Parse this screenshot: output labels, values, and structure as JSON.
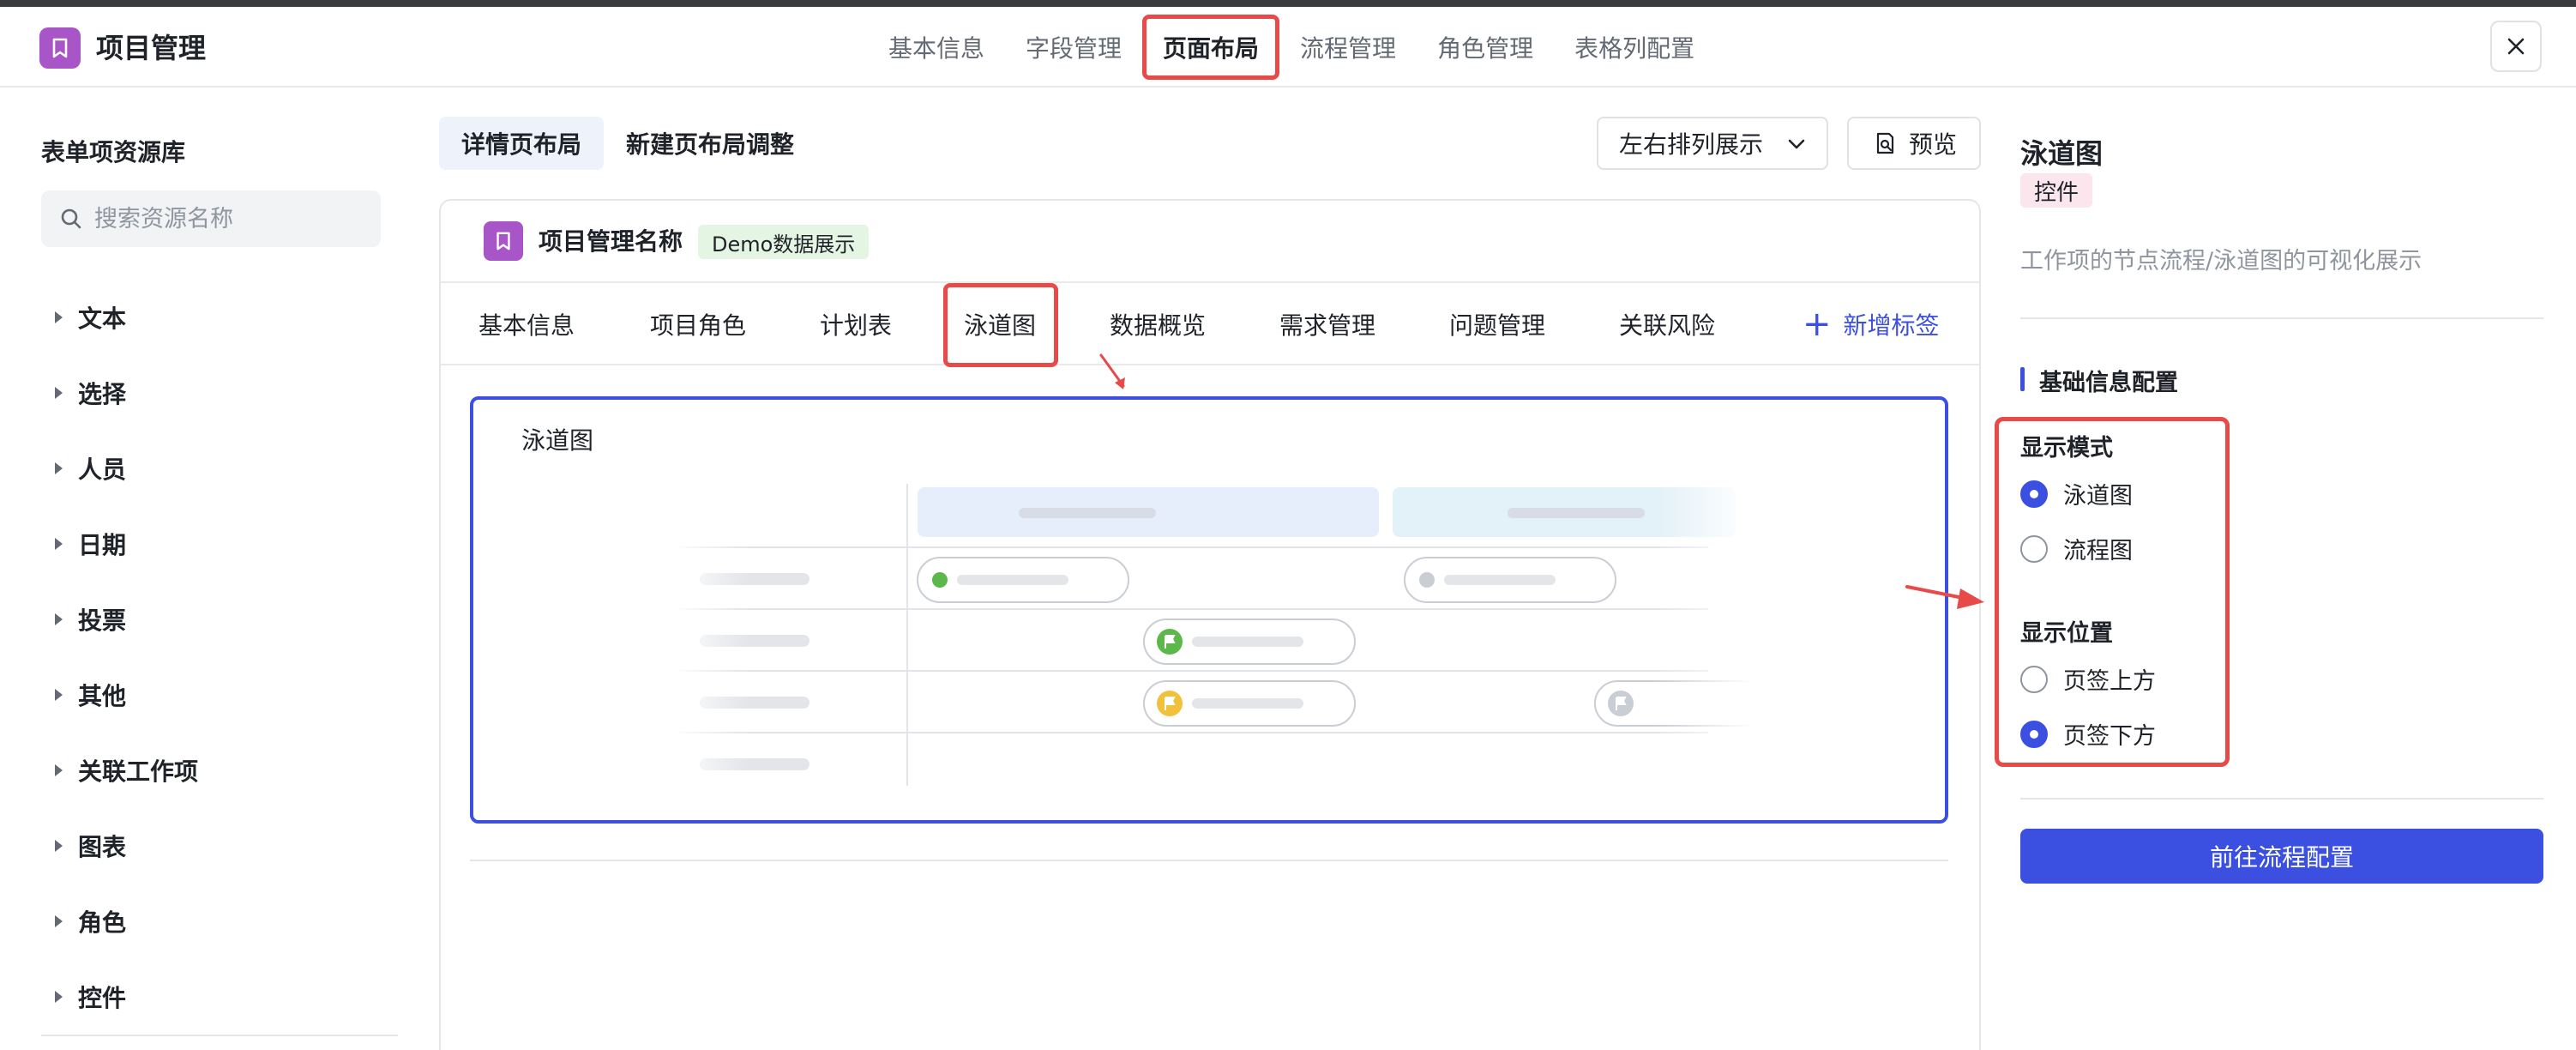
{
  "app": {
    "title": "项目管理"
  },
  "top_tabs": [
    {
      "label": "基本信息"
    },
    {
      "label": "字段管理"
    },
    {
      "label": "页面布局",
      "active": true
    },
    {
      "label": "流程管理"
    },
    {
      "label": "角色管理"
    },
    {
      "label": "表格列配置"
    }
  ],
  "sidebar": {
    "title": "表单项资源库",
    "search_placeholder": "搜索资源名称",
    "items": [
      {
        "label": "文本"
      },
      {
        "label": "选择"
      },
      {
        "label": "人员"
      },
      {
        "label": "日期"
      },
      {
        "label": "投票"
      },
      {
        "label": "其他"
      },
      {
        "label": "关联工作项"
      },
      {
        "label": "图表"
      },
      {
        "label": "角色"
      },
      {
        "label": "控件"
      }
    ]
  },
  "layout_tabs": [
    {
      "label": "详情页布局",
      "active": true
    },
    {
      "label": "新建页布局调整"
    }
  ],
  "toolbar": {
    "arrange_select": "左右排列展示",
    "preview_label": "预览"
  },
  "card": {
    "title": "项目管理名称",
    "badge": "Demo数据展示",
    "tabs": [
      {
        "label": "基本信息"
      },
      {
        "label": "项目角色"
      },
      {
        "label": "计划表"
      },
      {
        "label": "泳道图",
        "active": true
      },
      {
        "label": "数据概览"
      },
      {
        "label": "需求管理"
      },
      {
        "label": "问题管理"
      },
      {
        "label": "关联风险"
      }
    ],
    "add_tab_label": "新增标签",
    "swimlane_title": "泳道图"
  },
  "right_panel": {
    "title": "泳道图",
    "badge": "控件",
    "description": "工作项的节点流程/泳道图的可视化展示",
    "section_title": "基础信息配置",
    "display_mode": {
      "label": "显示模式",
      "options": [
        {
          "label": "泳道图",
          "checked": true
        },
        {
          "label": "流程图",
          "checked": false
        }
      ]
    },
    "display_position": {
      "label": "显示位置",
      "options": [
        {
          "label": "页签上方",
          "checked": false
        },
        {
          "label": "页签下方",
          "checked": true
        }
      ]
    },
    "action_button": "前往流程配置"
  },
  "colors": {
    "accent": "#3b50e0",
    "highlight_red": "#e84a4a",
    "logo_purple": "#a855c7",
    "badge_green_bg": "#e4f5e4",
    "badge_pink_bg": "#fbe6ee"
  }
}
